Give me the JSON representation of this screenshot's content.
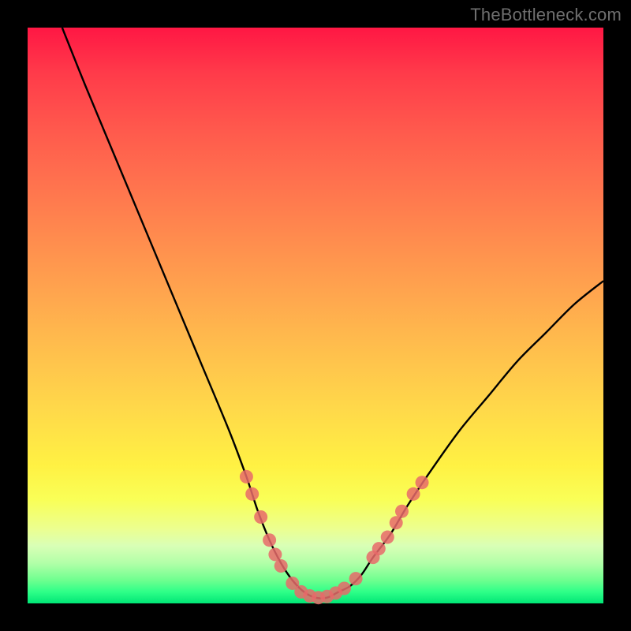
{
  "watermark": "TheBottleneck.com",
  "colors": {
    "frame": "#000000",
    "curve": "#000000",
    "marker_fill": "#e86a6a",
    "marker_stroke": "#d95555",
    "gradient_top": "#ff1744",
    "gradient_bottom": "#00e676",
    "watermark": "#6f6f6f"
  },
  "chart_data": {
    "type": "line",
    "title": "",
    "xlabel": "",
    "ylabel": "",
    "xlim": [
      0,
      100
    ],
    "ylim": [
      0,
      100
    ],
    "series": [
      {
        "name": "bottleneck-curve",
        "x": [
          6,
          10,
          15,
          20,
          25,
          30,
          35,
          38,
          40,
          42,
          44,
          46,
          48,
          50,
          52,
          54,
          56,
          58,
          60,
          63,
          66,
          70,
          75,
          80,
          85,
          90,
          95,
          100
        ],
        "y": [
          100,
          90,
          78,
          66,
          54,
          42,
          30,
          22,
          16,
          11,
          7,
          4,
          2,
          1,
          1,
          2,
          3,
          5,
          8,
          12,
          17,
          23,
          30,
          36,
          42,
          47,
          52,
          56
        ]
      }
    ],
    "markers": [
      {
        "x": 38,
        "y": 22
      },
      {
        "x": 39,
        "y": 19
      },
      {
        "x": 40.5,
        "y": 15
      },
      {
        "x": 42,
        "y": 11
      },
      {
        "x": 43,
        "y": 8.5
      },
      {
        "x": 44,
        "y": 6.5
      },
      {
        "x": 46,
        "y": 3.5
      },
      {
        "x": 47.5,
        "y": 2
      },
      {
        "x": 49,
        "y": 1.3
      },
      {
        "x": 50.5,
        "y": 1
      },
      {
        "x": 52,
        "y": 1.2
      },
      {
        "x": 53.5,
        "y": 1.8
      },
      {
        "x": 55,
        "y": 2.6
      },
      {
        "x": 57,
        "y": 4.3
      },
      {
        "x": 60,
        "y": 8
      },
      {
        "x": 61,
        "y": 9.5
      },
      {
        "x": 62.5,
        "y": 11.5
      },
      {
        "x": 64,
        "y": 14
      },
      {
        "x": 65,
        "y": 16
      },
      {
        "x": 67,
        "y": 19
      },
      {
        "x": 68.5,
        "y": 21
      }
    ]
  }
}
